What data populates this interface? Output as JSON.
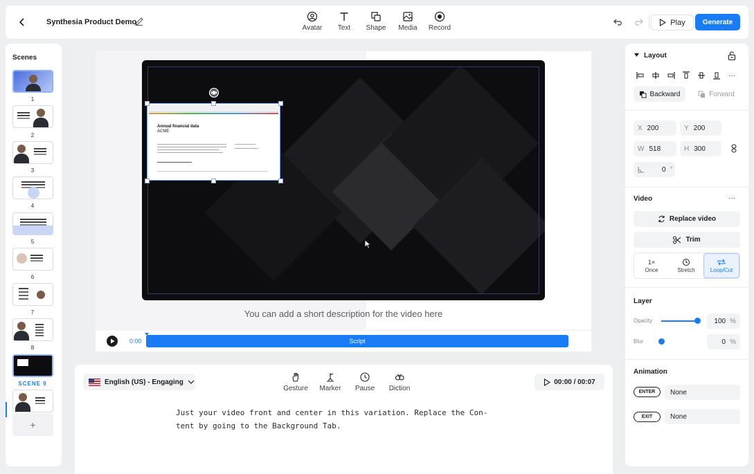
{
  "header": {
    "project_title": "Synthesia Product Demo",
    "tools": [
      {
        "label": "Avatar",
        "icon": "avatar-icon"
      },
      {
        "label": "Text",
        "icon": "text-icon"
      },
      {
        "label": "Shape",
        "icon": "shape-icon"
      },
      {
        "label": "Media",
        "icon": "media-icon"
      },
      {
        "label": "Record",
        "icon": "record-icon"
      }
    ],
    "play_label": "Play",
    "generate_label": "Generate"
  },
  "scenes": {
    "title": "Scenes",
    "numbers": [
      "1",
      "2",
      "3",
      "4",
      "5",
      "6",
      "7",
      "8",
      "SCENE 9"
    ],
    "active_index": 9
  },
  "canvas": {
    "doc_title": "Annual financial data",
    "doc_subtitle": "ACME",
    "description": "You can add a short description for the video here"
  },
  "timeline": {
    "current_time": "0:00",
    "track_label": "Script"
  },
  "script": {
    "language": "English (US) - Engaging",
    "tools": [
      {
        "label": "Gesture",
        "icon": "gesture-icon"
      },
      {
        "label": "Marker",
        "icon": "marker-icon"
      },
      {
        "label": "Pause",
        "icon": "pause-icon"
      },
      {
        "label": "Diction",
        "icon": "diction-icon"
      }
    ],
    "duration": "00:00 / 00:07",
    "text_line1": "Just your video front and center in this variation. Replace the Con-",
    "text_line2": "tent by going to the Background Tab."
  },
  "props": {
    "layout": {
      "title": "Layout",
      "backward": "Backward",
      "forward": "Forward",
      "x_label": "X",
      "x_value": "200",
      "y_label": "Y",
      "y_value": "200",
      "w_label": "W",
      "w_value": "518",
      "h_label": "H",
      "h_value": "300",
      "rotation_value": "0",
      "rotation_unit": "°"
    },
    "video": {
      "title": "Video",
      "more": "···",
      "replace": "Replace video",
      "trim": "Trim",
      "modes": [
        {
          "label": "Once",
          "icon_text": "1×"
        },
        {
          "label": "Stretch",
          "icon": "stretch-icon"
        },
        {
          "label": "Loop/Cut",
          "icon": "loop-icon"
        }
      ],
      "selected_mode": "Loop/Cut"
    },
    "layer": {
      "title": "Layer",
      "opacity_label": "Opacity",
      "opacity_value": "100",
      "opacity_fraction": 1.0,
      "blur_label": "Blur",
      "blur_value": "0",
      "blur_fraction": 0.0,
      "unit": "%"
    },
    "animation": {
      "title": "Animation",
      "enter_label": "ENTER",
      "enter_value": "None",
      "exit_label": "EXIT",
      "exit_value": "None"
    }
  },
  "colors": {
    "accent": "#1a7cf5",
    "background": "#eeeff1",
    "video_bg": "#0d0d0f"
  }
}
